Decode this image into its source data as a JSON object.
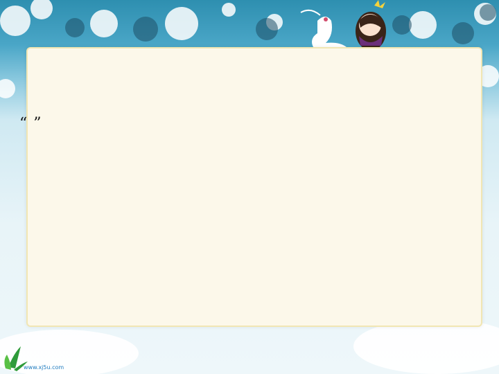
{
  "slide": {
    "title": "",
    "line1": "",
    "line2": "",
    "line3": "“ ”",
    "line4": ""
  },
  "logo": {
    "name": "",
    "url": "www.xj5u.com"
  },
  "colors": {
    "title": "#cc1f1f",
    "card": "#fcf8ea",
    "sky_top": "#2e8fb0"
  }
}
